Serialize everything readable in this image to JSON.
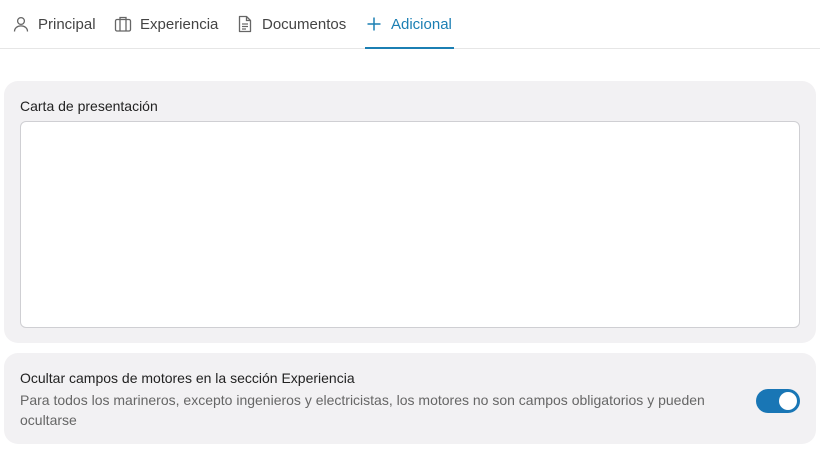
{
  "tabs": [
    {
      "label": "Principal",
      "icon": "user-icon",
      "active": false
    },
    {
      "label": "Experiencia",
      "icon": "briefcase-icon",
      "active": false
    },
    {
      "label": "Documentos",
      "icon": "document-icon",
      "active": false
    },
    {
      "label": "Adicional",
      "icon": "plus-icon",
      "active": true
    }
  ],
  "cover_letter": {
    "label": "Carta de presentación",
    "value": ""
  },
  "hide_engines": {
    "title": "Ocultar campos de motores en la sección Experiencia",
    "description": "Para todos los marineros, excepto ingenieros y electricistas, los motores no son campos obligatorios y pueden ocultarse",
    "enabled": true
  },
  "colors": {
    "accent": "#1b7fb3",
    "toggle_on": "#1976b5",
    "card_bg": "#f2f1f3"
  }
}
